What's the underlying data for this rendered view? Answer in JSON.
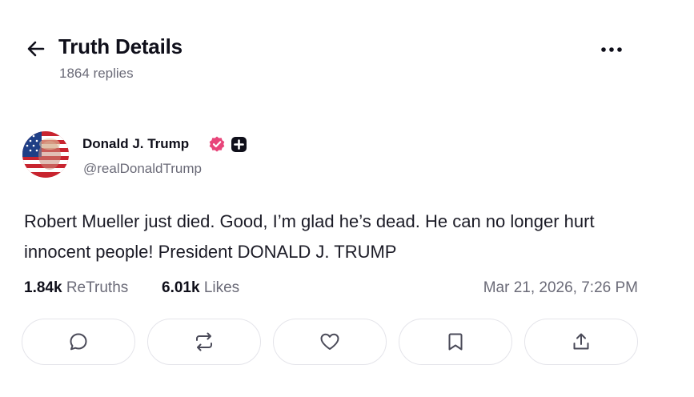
{
  "header": {
    "title": "Truth Details",
    "reply_count": "1864 replies",
    "back_icon": "arrow-left-icon",
    "more_icon": "more-horizontal-icon"
  },
  "post": {
    "author": {
      "name": "Donald J. Trump",
      "handle": "@realDonaldTrump",
      "verified_badge_color": "#e8457a",
      "badge_icon": "plus-square-icon"
    },
    "text": "Robert Mueller just died. Good, I’m glad he’s dead. He can no longer hurt innocent people! President DONALD J. TRUMP",
    "stats": {
      "retruths_count": "1.84k",
      "retruths_label": "ReTruths",
      "likes_count": "6.01k",
      "likes_label": "Likes"
    },
    "timestamp": "Mar 21, 2026, 7:26 PM"
  },
  "actions": [
    {
      "name": "reply",
      "icon": "comment-icon"
    },
    {
      "name": "retruth",
      "icon": "repost-icon"
    },
    {
      "name": "like",
      "icon": "heart-icon"
    },
    {
      "name": "bookmark",
      "icon": "bookmark-icon"
    },
    {
      "name": "share",
      "icon": "share-upload-icon"
    }
  ],
  "colors": {
    "text_primary": "#0f0f1a",
    "text_secondary": "#6b6b78",
    "border": "#e4e4ea"
  }
}
